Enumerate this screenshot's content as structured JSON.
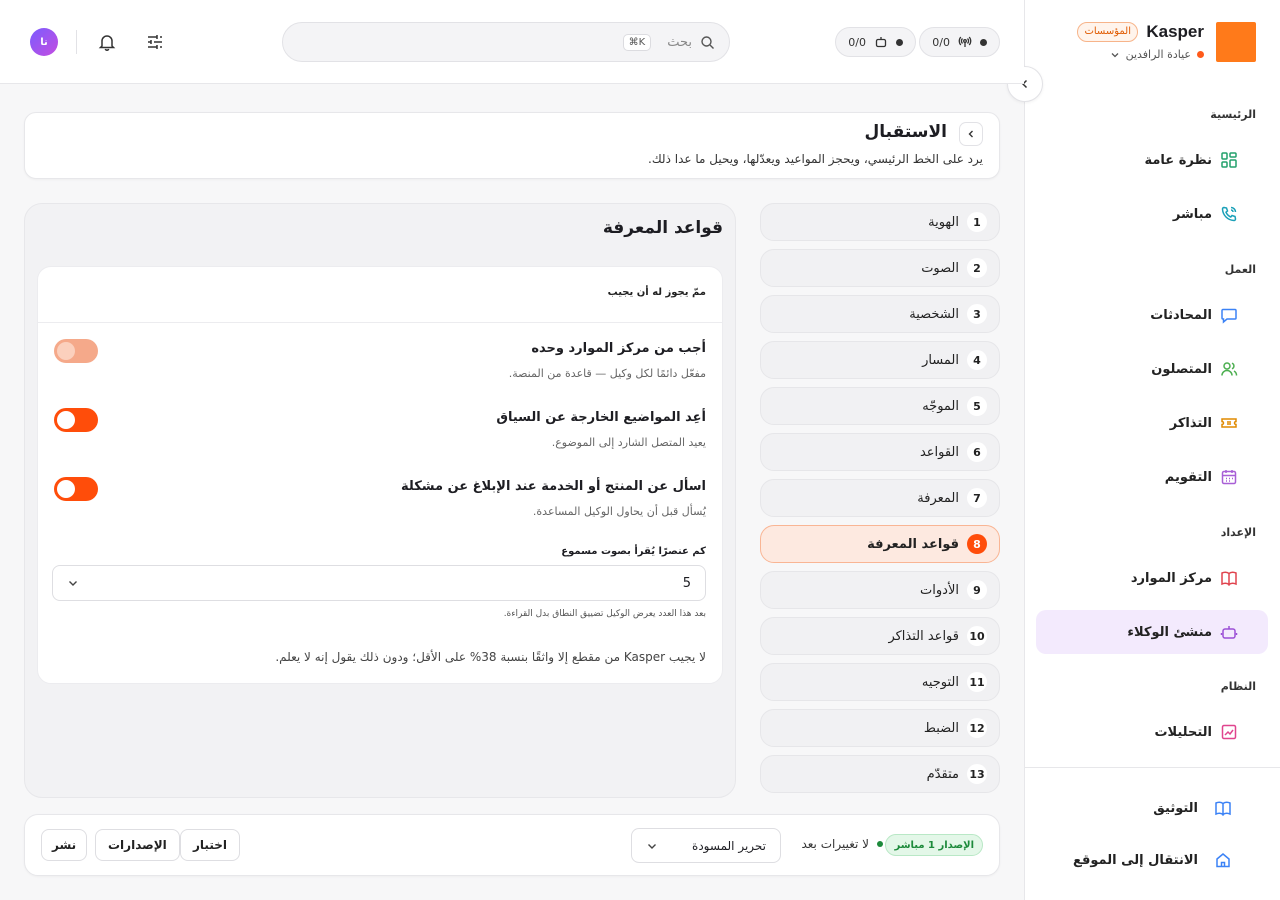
{
  "brand": {
    "name": "Kasper",
    "badge": "المؤسسات",
    "org": "عيادة الرافدين"
  },
  "topbar": {
    "pill_calls": "0/0",
    "pill_bots": "0/0",
    "search_placeholder": "بحث",
    "search_shortcut": "⌘K",
    "avatar_initials": "نا"
  },
  "sidebar": {
    "sections": {
      "home": "الرئيسية",
      "work": "العمل",
      "setup": "الإعداد",
      "system": "النظام"
    },
    "items": [
      {
        "label": "نظرة عامة",
        "icon": "grid-icon",
        "color": "#22a06b"
      },
      {
        "label": "مباشر",
        "icon": "phone-call-icon",
        "color": "#1aa0b8"
      },
      {
        "label": "المحادثات",
        "icon": "chat-icon",
        "color": "#3b82f6"
      },
      {
        "label": "المتصلون",
        "icon": "users-icon",
        "color": "#4caf50"
      },
      {
        "label": "التذاكر",
        "icon": "ticket-icon",
        "color": "#e08a00"
      },
      {
        "label": "التقويم",
        "icon": "calendar-icon",
        "color": "#a85fd6"
      },
      {
        "label": "مركز الموارد",
        "icon": "book-icon",
        "color": "#e0444e"
      },
      {
        "label": "منشئ الوكلاء",
        "icon": "robot-icon",
        "color": "#9b4fd6"
      },
      {
        "label": "التحليلات",
        "icon": "chart-icon",
        "color": "#e0448e"
      }
    ],
    "footer": [
      {
        "label": "التوثيق",
        "icon": "docs-book-icon",
        "color": "#3b82f6"
      },
      {
        "label": "الانتقال إلى الموقع",
        "icon": "home-icon",
        "color": "#3b82f6"
      }
    ]
  },
  "header": {
    "title": "الاستقبال",
    "description": "يرد على الخط الرئيسي، ويحجز المواعيد ويعدّلها، ويحيل ما عدا ذلك."
  },
  "steps": [
    {
      "num": "1",
      "label": "الهوية"
    },
    {
      "num": "2",
      "label": "الصوت"
    },
    {
      "num": "3",
      "label": "الشخصية"
    },
    {
      "num": "4",
      "label": "المسار"
    },
    {
      "num": "5",
      "label": "الموجّه"
    },
    {
      "num": "6",
      "label": "القواعد"
    },
    {
      "num": "7",
      "label": "المعرفة"
    },
    {
      "num": "8",
      "label": "قواعد المعرفة",
      "active": true
    },
    {
      "num": "9",
      "label": "الأدوات"
    },
    {
      "num": "10",
      "label": "قواعد التذاكر"
    },
    {
      "num": "11",
      "label": "التوجيه"
    },
    {
      "num": "12",
      "label": "الضبط"
    },
    {
      "num": "13",
      "label": "متقدّم"
    }
  ],
  "panel": {
    "title": "قواعد المعرفة",
    "card_label": "ممّ يجوز له أن يجيب",
    "rules": [
      {
        "title": "أجب من مركز الموارد وحده",
        "desc": "مفعّل دائمًا لكل وكيل — قاعدة من المنصة.",
        "on": true,
        "locked": true
      },
      {
        "title": "أعِد المواضيع الخارجة عن السياق",
        "desc": "يعيد المتصل الشارد إلى الموضوع.",
        "on": true,
        "locked": false
      },
      {
        "title": "اسأل عن المنتج أو الخدمة عند الإبلاغ عن مشكلة",
        "desc": "يُسأل قبل أن يحاول الوكيل المساعدة.",
        "on": true,
        "locked": false
      }
    ],
    "count_label": "كم عنصرًا يُقرأ بصوت مسموع",
    "count_value": "5",
    "count_hint": "بعد هذا العدد يعرض الوكيل تضييق النطاق بدل القراءة.",
    "footnote": "لا يجيب Kasper من مقطع إلا واثقًا بنسبة 38% على الأقل؛ ودون ذلك يقول إنه لا يعلم."
  },
  "bottom": {
    "version": "الإصدار 1 مباشر",
    "status": "لا تغييرات بعد",
    "draft": "تحرير المسودة",
    "test": "اختبار",
    "versions": "الإصدارات",
    "publish": "نشر"
  }
}
